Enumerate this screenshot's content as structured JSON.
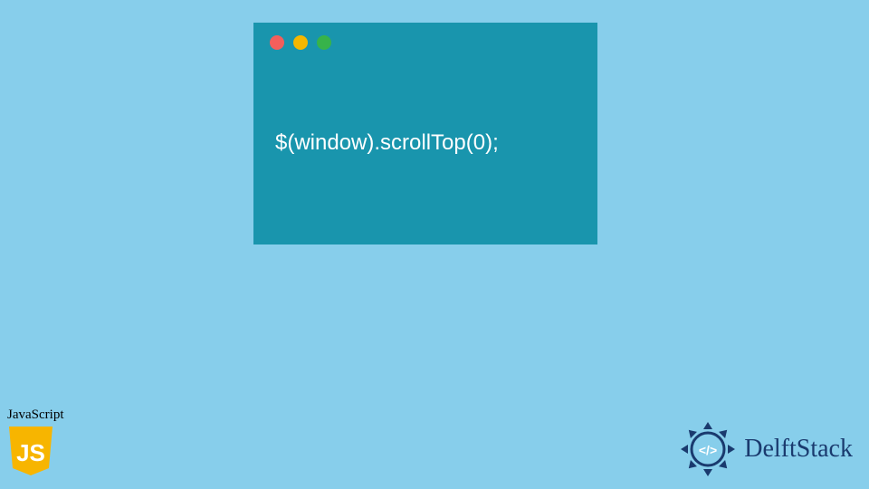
{
  "window": {
    "dots": {
      "red": "#F25F5C",
      "yellow": "#F5B700",
      "green": "#37B34A"
    },
    "background": "#1995AD"
  },
  "code": {
    "line1": "$(window).scrollTop(0);"
  },
  "tag": {
    "label": "JavaScript",
    "shield_letters": "JS",
    "shield_color": "#F7B500"
  },
  "brand": {
    "name": "DelftStack",
    "logo_accent": "#1A3A6E"
  },
  "colors": {
    "page_bg": "#87CEEB",
    "code_text": "#FFFFFF"
  }
}
